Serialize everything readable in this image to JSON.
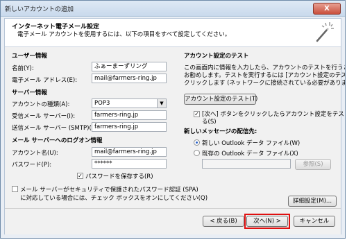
{
  "window": {
    "title": "新しいアカウントの追加",
    "close_glyph": "X"
  },
  "header": {
    "title": "インターネット電子メール設定",
    "subtitle": "電子メール アカウントを使用するには、以下の項目をすべて設定してください。",
    "icon": "magic-wand-icon"
  },
  "user_info": {
    "heading": "ユーザー情報",
    "name_label": "名前(Y):",
    "name_value": "ふぁーまーずリング",
    "email_label": "電子メール アドレス(E):",
    "email_value": "mail@farmers-ring.jp"
  },
  "server_info": {
    "heading": "サーバー情報",
    "account_type_label": "アカウントの種類(A):",
    "account_type_value": "POP3",
    "incoming_label": "受信メール サーバー(I):",
    "incoming_value": "farmers-ring.jp",
    "outgoing_label": "送信メール サーバー (SMTP)(O):",
    "outgoing_value": "farmers-ring.jp"
  },
  "logon_info": {
    "heading": "メール サーバーへのログオン情報",
    "account_label": "アカウント名(U):",
    "account_value": "mail@farmers-ring.jp",
    "password_label": "パスワード(P):",
    "password_value": "******",
    "remember_label": "パスワードを保存する(R)",
    "remember_checked": true,
    "spa_line1": "メール サーバーがセキュリティで保護されたパスワード認証 (SPA)",
    "spa_line2": "に対応している場合には、チェック ボックスをオンにしてください(Q)",
    "spa_checked": false
  },
  "test": {
    "heading": "アカウント設定のテスト",
    "desc1": "この画面内に情報を入力したら、アカウントのテストを行うことを",
    "desc2": "お勧めします。テストを実行するには [アカウント設定のテスト] を",
    "desc3": "クリックします (ネットワークに接続されている必要があります)。",
    "button": "アカウント設定のテスト(T)",
    "auto_line1": "[次へ] ボタンをクリックしたらアカウント設定をテストす",
    "auto_line2": "る(S)",
    "auto_checked": true
  },
  "delivery": {
    "heading": "新しいメッセージの配信先:",
    "option_new": "新しい Outlook データ ファイル(W)",
    "option_existing": "既存の Outlook データ ファイル(X)",
    "selected": "new",
    "browse_button": "参照(S)"
  },
  "more_settings_button": "詳細設定(M)...",
  "footer": {
    "back_button": "< 戻る(B)",
    "next_button": "次へ(N) >",
    "cancel_button": "キャンセル"
  },
  "colors": {
    "highlight": "#e01010",
    "accent": "#2a62c8"
  }
}
